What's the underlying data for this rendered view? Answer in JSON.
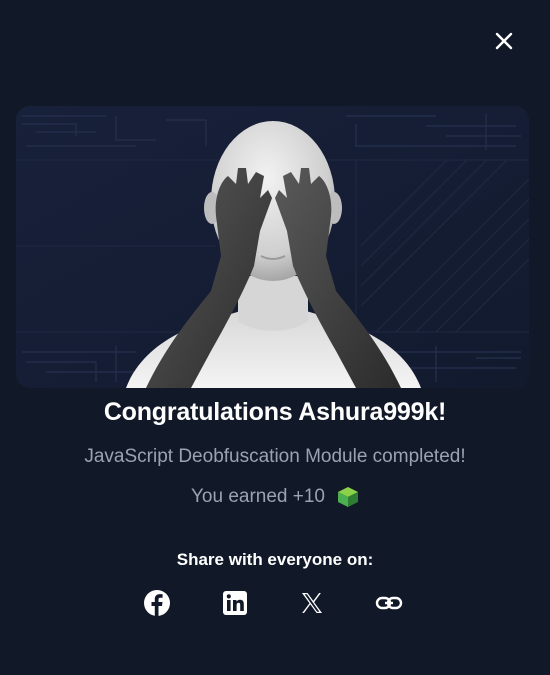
{
  "modal": {
    "close_icon": "close-icon",
    "title": "Congratulations Ashura999k!",
    "subtitle": "JavaScript Deobfuscation Module completed!",
    "earned_text": "You earned +10",
    "earned_icon": "cube-icon",
    "share_label": "Share with everyone on:",
    "share_buttons": [
      {
        "icon": "facebook-icon"
      },
      {
        "icon": "linkedin-icon"
      },
      {
        "icon": "x-icon"
      },
      {
        "icon": "link-icon"
      }
    ]
  },
  "colors": {
    "background": "#111827",
    "text_primary": "#ffffff",
    "text_secondary": "#9aa3b2",
    "cube_green": "#4caf50"
  }
}
